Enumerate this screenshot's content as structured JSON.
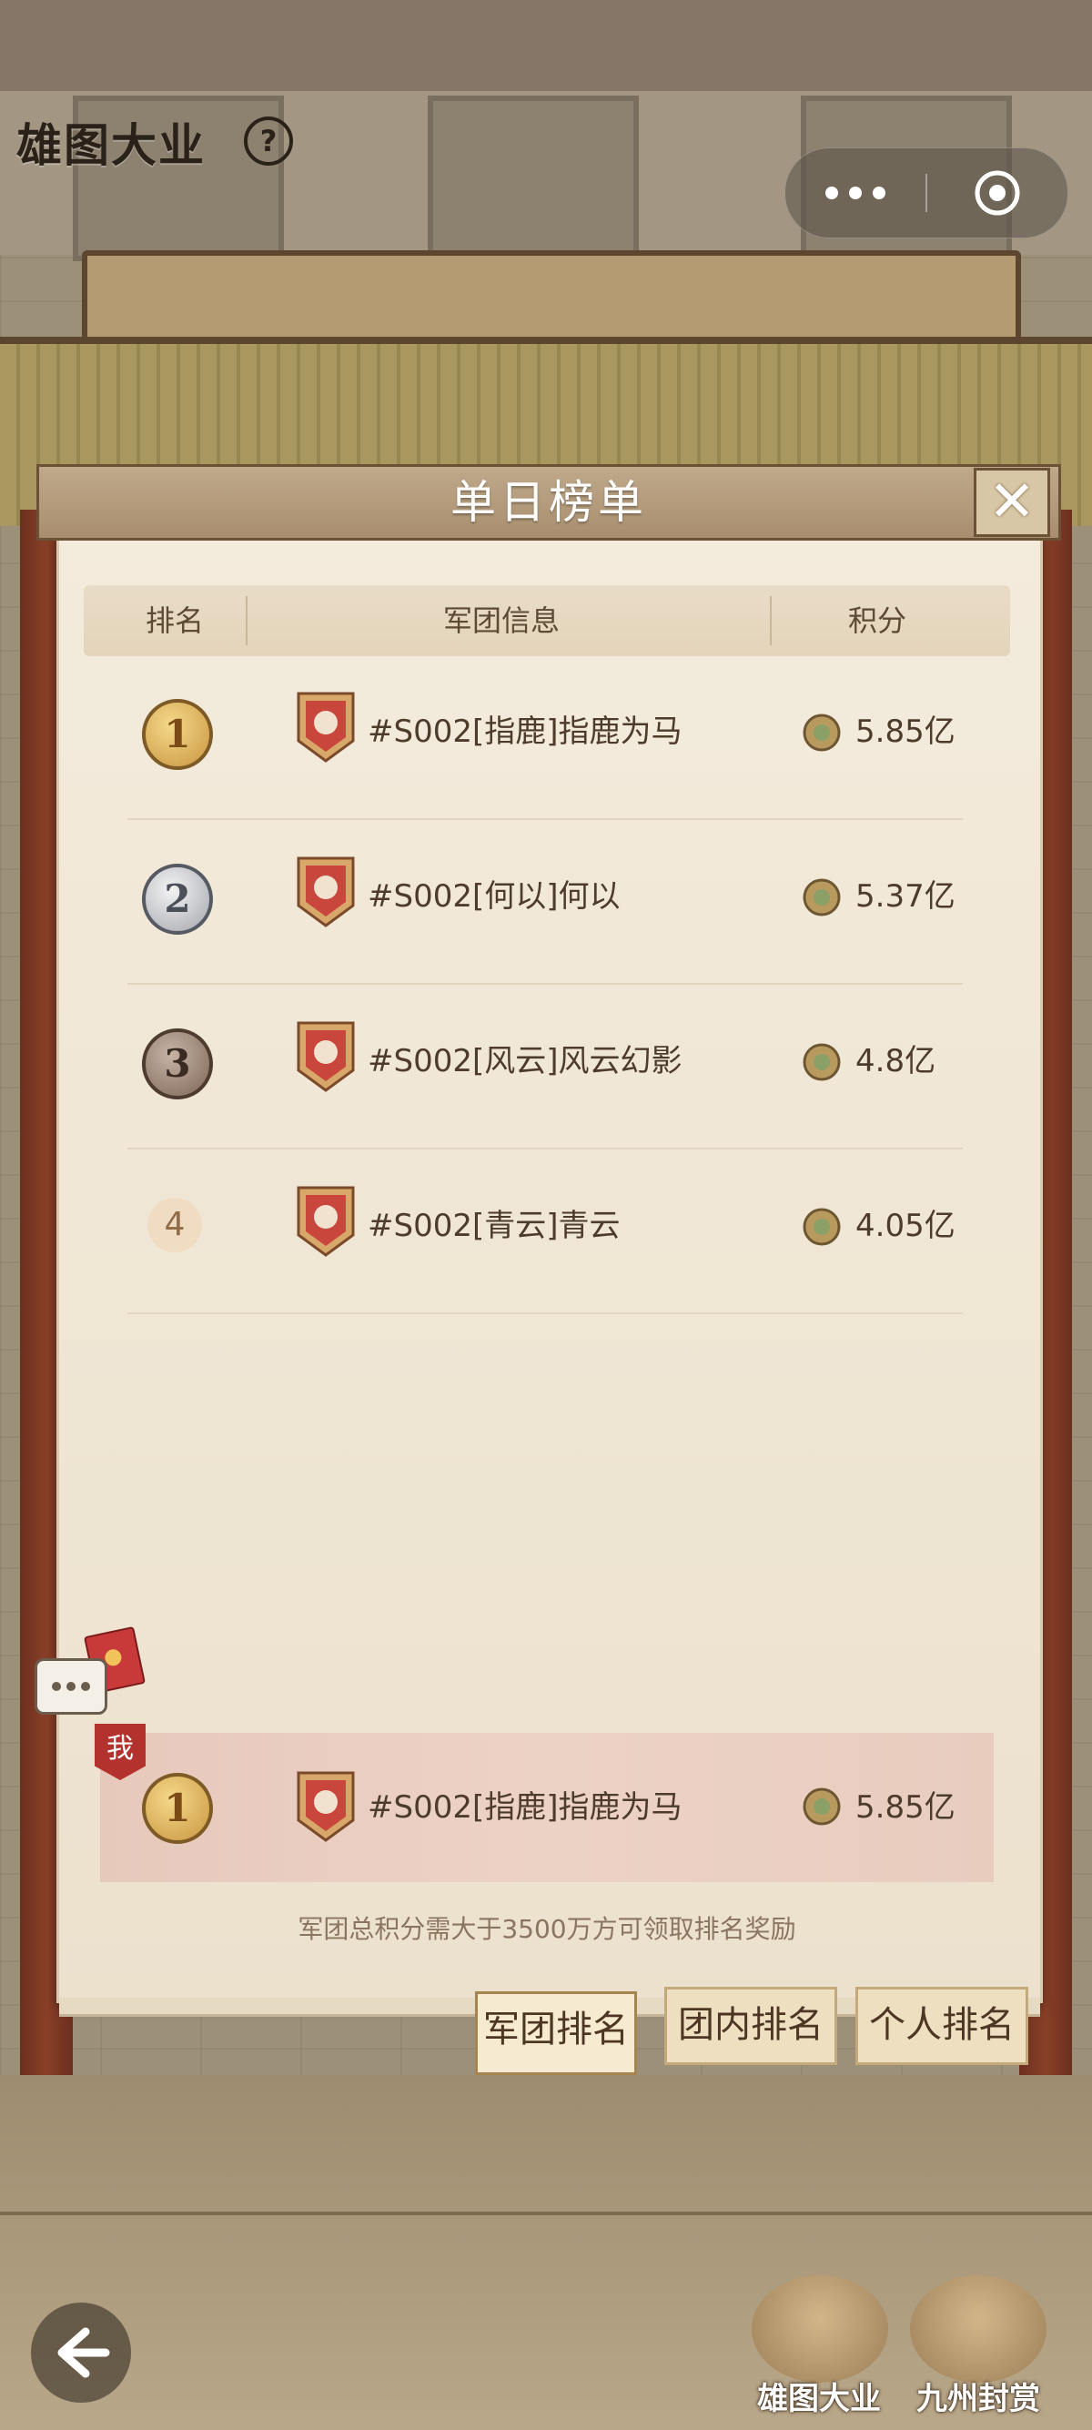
{
  "app": {
    "title": "雄图大业",
    "help_icon": "?"
  },
  "panel": {
    "title": "单日榜单",
    "columns": {
      "rank": "排名",
      "team": "军团信息",
      "score": "积分"
    },
    "rows": [
      {
        "rank": "1",
        "team": "#S002[指鹿]指鹿为马",
        "score": "5.85亿"
      },
      {
        "rank": "2",
        "team": "#S002[何以]何以",
        "score": "5.37亿"
      },
      {
        "rank": "3",
        "team": "#S002[风云]风云幻影",
        "score": "4.8亿"
      },
      {
        "rank": "4",
        "team": "#S002[青云]青云",
        "score": "4.05亿"
      }
    ],
    "my_row": {
      "tag": "我",
      "rank": "1",
      "team": "#S002[指鹿]指鹿为马",
      "score": "5.85亿"
    },
    "note": "军团总积分需大于3500万方可领取排名奖励"
  },
  "tabs": [
    {
      "label": "军团排名",
      "active": true
    },
    {
      "label": "团内排名",
      "active": false
    },
    {
      "label": "个人排名",
      "active": false
    }
  ],
  "bottom_nav": [
    {
      "label": "雄图大业",
      "icon": "book-icon"
    },
    {
      "label": "九州封赏",
      "icon": "treasure-chest-icon"
    }
  ],
  "colors": {
    "gold": "#c9953f",
    "silver": "#a3a6ad",
    "bronze": "#7d6657",
    "tag_red": "#b4322d",
    "panel_bg": "#f3ebdc"
  }
}
